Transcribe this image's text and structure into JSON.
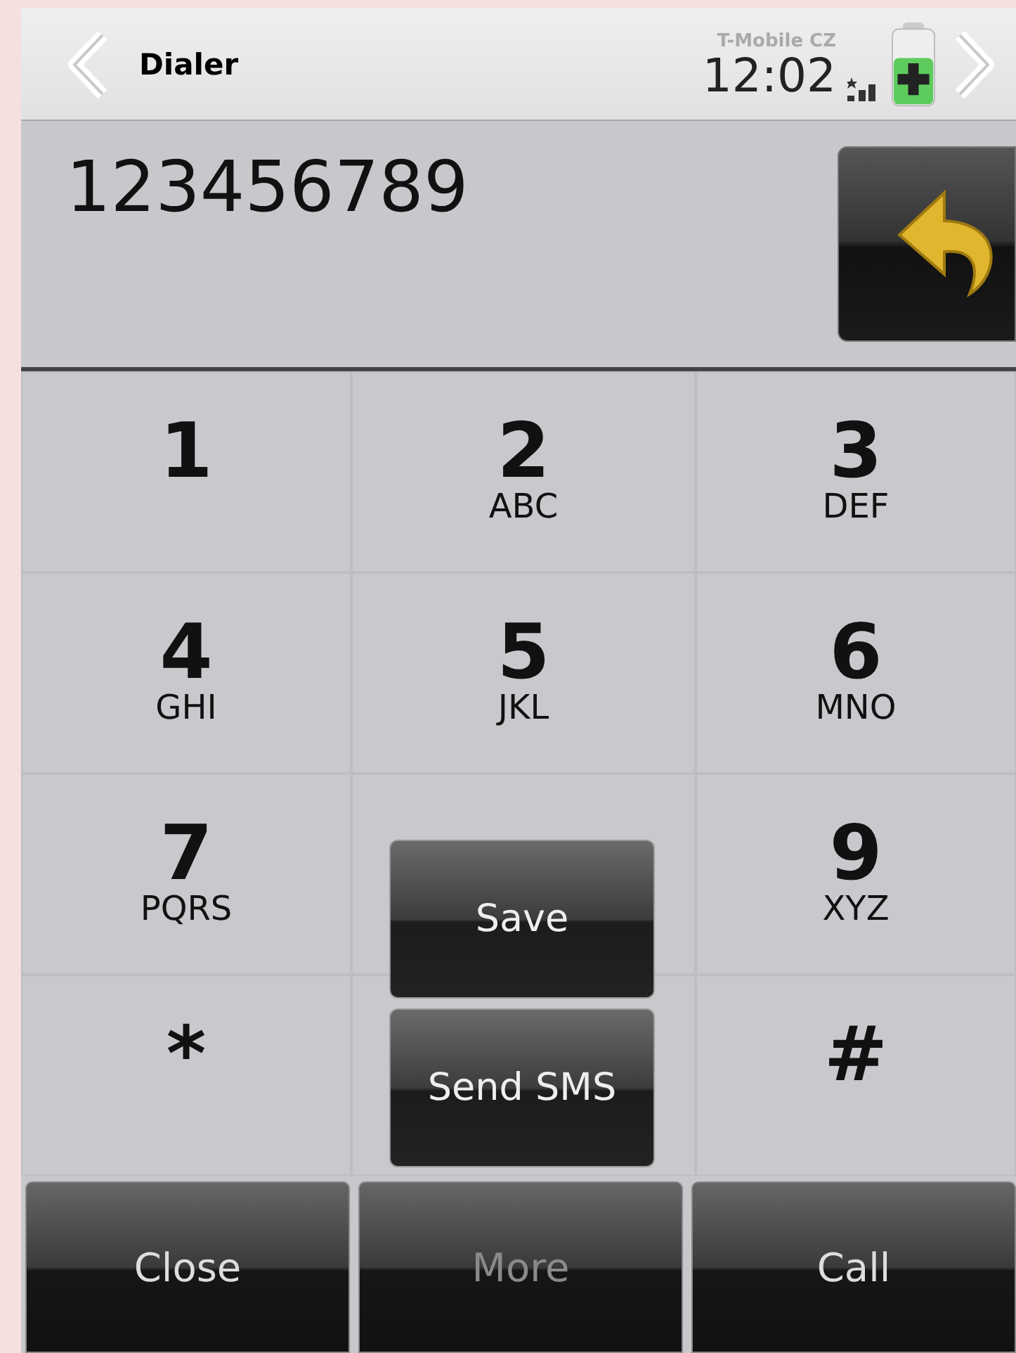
{
  "header": {
    "title": "Dialer",
    "carrier": "T-Mobile CZ",
    "time": "12:02"
  },
  "number": "123456789",
  "keys": [
    {
      "digit": "1"
    },
    {
      "digit": "2",
      "letters": "ABC"
    },
    {
      "digit": "3",
      "letters": "DEF"
    },
    {
      "digit": "4",
      "letters": "GHI"
    },
    {
      "digit": "5",
      "letters": "JKL"
    },
    {
      "digit": "6",
      "letters": "MNO"
    },
    {
      "digit": "7",
      "letters": "PQRS"
    },
    {
      "covered": true
    },
    {
      "digit": "9",
      "letters": "XYZ"
    },
    {
      "digit": "*"
    },
    {
      "digit": "#"
    }
  ],
  "popup_menu": [
    "Save",
    "Send SMS"
  ],
  "bottom_buttons": [
    {
      "label": "Close",
      "open": false
    },
    {
      "label": "More",
      "open": true
    },
    {
      "label": "Call",
      "open": false
    }
  ]
}
